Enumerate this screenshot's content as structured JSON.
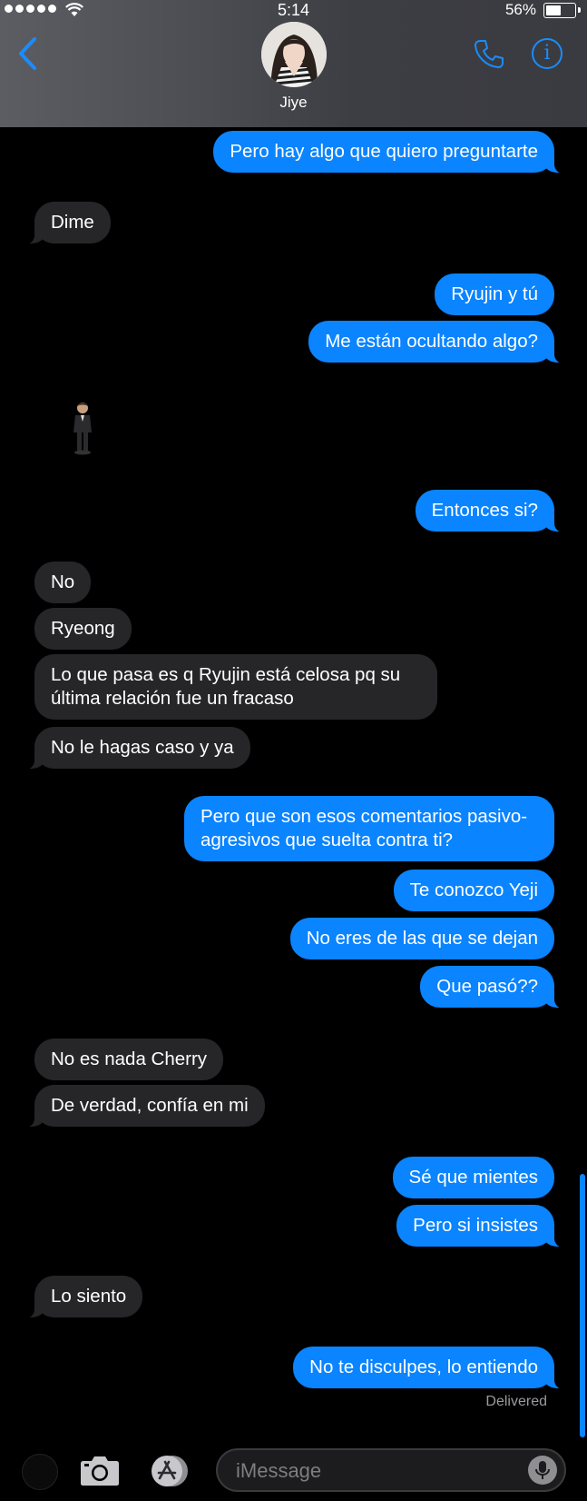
{
  "status_bar": {
    "time": "5:14",
    "battery_percent": "56%",
    "battery_level": 0.56
  },
  "header": {
    "contact_name": "Jiye"
  },
  "messages": [
    {
      "side": "out",
      "text": "Pero hay algo que quiero preguntarte"
    },
    {
      "side": "in",
      "text": "Dime"
    },
    {
      "side": "out",
      "text": "Ryujin y tú"
    },
    {
      "side": "out",
      "text": "Me están ocultando algo?"
    },
    {
      "side": "out",
      "text": "Entonces si?"
    },
    {
      "side": "in",
      "text": "No"
    },
    {
      "side": "in",
      "text": "Ryeong"
    },
    {
      "side": "in",
      "text": "Lo que pasa es q Ryujin está celosa pq su última relación fue un fracaso"
    },
    {
      "side": "in",
      "text": "No le hagas caso y ya"
    },
    {
      "side": "out",
      "text": "Pero que son esos comentarios pasivo-agresivos que suelta contra ti?"
    },
    {
      "side": "out",
      "text": "Te conozco Yeji"
    },
    {
      "side": "out",
      "text": "No eres de las que se dejan"
    },
    {
      "side": "out",
      "text": "Que pasó??"
    },
    {
      "side": "in",
      "text": "No es nada Cherry"
    },
    {
      "side": "in",
      "text": "De verdad, confía en mi"
    },
    {
      "side": "out",
      "text": "Sé que mientes"
    },
    {
      "side": "out",
      "text": "Pero si insistes"
    },
    {
      "side": "in",
      "text": "Lo siento"
    },
    {
      "side": "out",
      "text": "No te disculpes, lo entiendo"
    }
  ],
  "delivery_status": "Delivered",
  "composer": {
    "placeholder": "iMessage"
  },
  "colors": {
    "outgoing_bubble": "#0a84ff",
    "incoming_bubble": "#262629",
    "accent": "#1a8cff"
  }
}
